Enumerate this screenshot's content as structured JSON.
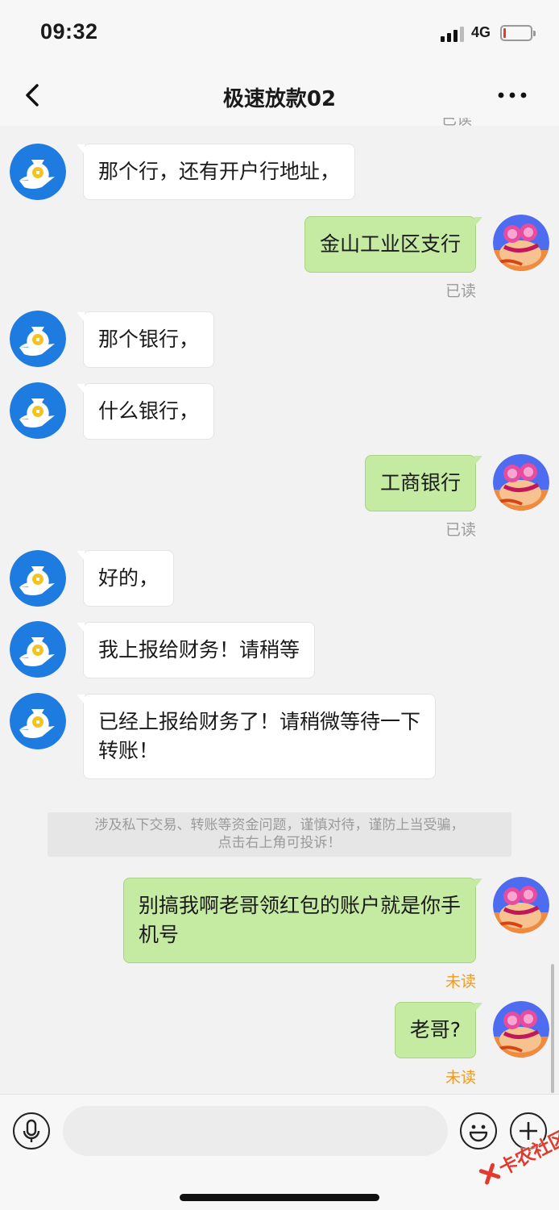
{
  "status_bar": {
    "time": "09:32",
    "network": "4G",
    "battery_level": 0.1,
    "battery_color": "#e53935"
  },
  "nav": {
    "back_icon": "chevron-left-icon",
    "title": "极速放款02",
    "more_icon": "more-dots-icon"
  },
  "chat": {
    "top_read_fragment": "已读",
    "messages": [
      {
        "side": "left",
        "text": "那个行，还有开户行地址，",
        "avatar": "money-bag-avatar"
      },
      {
        "side": "right",
        "text": "金山工业区支行",
        "receipt": "已读",
        "avatar": "cartoon-avatar"
      },
      {
        "side": "left",
        "text": "那个银行，",
        "avatar": "money-bag-avatar"
      },
      {
        "side": "left",
        "text": "什么银行，",
        "avatar": "money-bag-avatar"
      },
      {
        "side": "right",
        "text": "工商银行",
        "receipt": "已读",
        "avatar": "cartoon-avatar"
      },
      {
        "side": "left",
        "text": "好的，",
        "avatar": "money-bag-avatar"
      },
      {
        "side": "left",
        "text": "我上报给财务！请稍等",
        "avatar": "money-bag-avatar"
      },
      {
        "side": "left",
        "text": "已经上报给财务了！请稍微等待一下\n转账！",
        "avatar": "money-bag-avatar"
      },
      {
        "side": "right",
        "text": "别搞我啊老哥领红包的账户就是你手\n机号",
        "receipt": "未读",
        "avatar": "cartoon-avatar"
      },
      {
        "side": "right",
        "text": "老哥?",
        "receipt": "未读",
        "avatar": "cartoon-avatar"
      }
    ],
    "notice": {
      "line1": "涉及私下交易、转账等资金问题，谨慎对待，谨防上当受骗，",
      "line2": "点击右上角可投诉！"
    }
  },
  "input_bar": {
    "voice_icon": "microphone-icon",
    "input_value": "",
    "emoji_icon": "smiley-icon",
    "plus_icon": "plus-icon"
  },
  "colors": {
    "sent_bubble": "#c5eaa1",
    "received_bubble": "#ffffff",
    "unread": "#f29a1e",
    "read": "#9a9a9a",
    "money_bag_avatar": "#1e7be0"
  },
  "watermark": "卡农社区"
}
